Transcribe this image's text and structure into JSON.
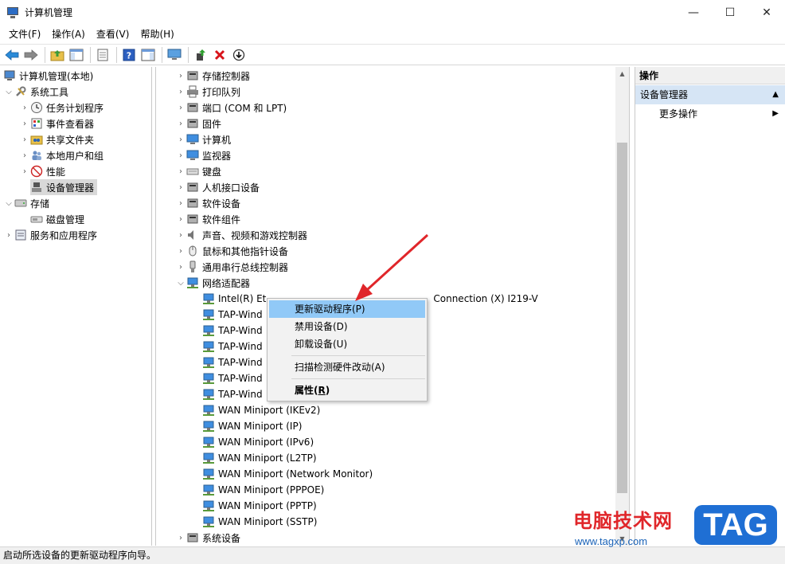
{
  "window": {
    "title": "计算机管理",
    "controls": {
      "minimize": "—",
      "maximize": "☐",
      "close": "✕"
    }
  },
  "menu": [
    "文件(F)",
    "操作(A)",
    "查看(V)",
    "帮助(H)"
  ],
  "left_tree": {
    "root": "计算机管理(本地)",
    "system_tools": "系统工具",
    "task_scheduler": "任务计划程序",
    "event_viewer": "事件查看器",
    "shared_folders": "共享文件夹",
    "local_users": "本地用户和组",
    "performance": "性能",
    "device_manager": "设备管理器",
    "storage": "存储",
    "disk_management": "磁盘管理",
    "services_apps": "服务和应用程序"
  },
  "devices": {
    "categories": [
      "存储控制器",
      "打印队列",
      "端口 (COM 和 LPT)",
      "固件",
      "计算机",
      "监视器",
      "键盘",
      "人机接口设备",
      "软件设备",
      "软件组件",
      "声音、视频和游戏控制器",
      "鼠标和其他指针设备",
      "通用串行总线控制器"
    ],
    "network_adapters": "网络适配器",
    "adapters": [
      "Intel(R) Et",
      "TAP-Wind",
      "TAP-Wind",
      "TAP-Wind",
      "TAP-Wind",
      "TAP-Wind",
      "TAP-Wind",
      "WAN Miniport (IKEv2)",
      "WAN Miniport (IP)",
      "WAN Miniport (IPv6)",
      "WAN Miniport (L2TP)",
      "WAN Miniport (Network Monitor)",
      "WAN Miniport (PPPOE)",
      "WAN Miniport (PPTP)",
      "WAN Miniport (SSTP)"
    ],
    "adapter0_tail": "Connection (X) I219-V",
    "system_devices": "系统设备"
  },
  "context_menu": {
    "update_driver": "更新驱动程序(P)",
    "disable_device": "禁用设备(D)",
    "uninstall_device": "卸载设备(U)",
    "scan_hardware": "扫描检测硬件改动(A)",
    "properties_prefix": "属性(",
    "properties_key": "R",
    "properties_suffix": ")"
  },
  "actions": {
    "header": "操作",
    "section": "设备管理器",
    "more": "更多操作"
  },
  "status": "启动所选设备的更新驱动程序向导。",
  "watermark": {
    "site": "电脑技术网",
    "url": "www.tagxp.com",
    "tag": "TAG"
  },
  "colors": {
    "selection": "#91c9f7",
    "accent_red": "#e0262a",
    "accent_blue": "#1f6fd4",
    "action_section": "#d6e5f5"
  }
}
